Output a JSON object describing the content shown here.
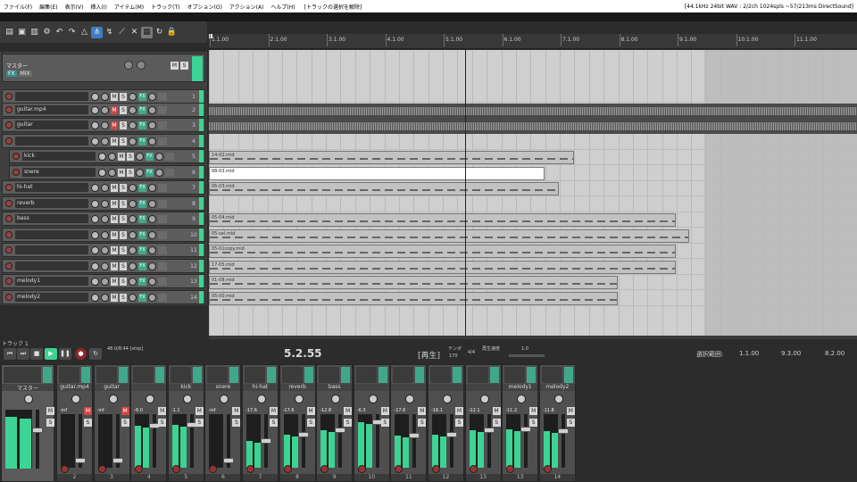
{
  "menu": {
    "items": [
      "ファイル(F)",
      "編集(E)",
      "表示(V)",
      "挿入(I)",
      "アイテム(M)",
      "トラック(T)",
      "オプション(O)",
      "アクション(A)",
      "ヘルプ(H)"
    ],
    "unselect_tracks": "[トラックの選択を解除]",
    "status": "[44.1kHz 24bit WAV : 2/2ch 1024spls ~57/213ms DirectSound]"
  },
  "ruler": {
    "ticks": [
      "1.1.00",
      "2.1.00",
      "3.1.00",
      "4.1.00",
      "5.1.00",
      "6.1.00",
      "7.1.00",
      "8.1.00",
      "9.1.00",
      "10.1.00",
      "11.1.00"
    ]
  },
  "master": {
    "label": "マスター",
    "fx": "FX",
    "io": "MIX",
    "mute": "M",
    "solo": "S"
  },
  "tracks": [
    {
      "name": "",
      "num": "1",
      "muted": false
    },
    {
      "name": "guitar.mp4",
      "num": "2",
      "muted": true
    },
    {
      "name": "guitar",
      "num": "3",
      "muted": true
    },
    {
      "name": "",
      "num": "4",
      "muted": false
    },
    {
      "name": "kick",
      "num": "5",
      "muted": false
    },
    {
      "name": "snere",
      "num": "6",
      "muted": false
    },
    {
      "name": "hi-hat",
      "num": "7",
      "muted": false
    },
    {
      "name": "reverb",
      "num": "8",
      "muted": false
    },
    {
      "name": "bass",
      "num": "9",
      "muted": false
    },
    {
      "name": "",
      "num": "10",
      "muted": false
    },
    {
      "name": "",
      "num": "11",
      "muted": false
    },
    {
      "name": "",
      "num": "12",
      "muted": false
    },
    {
      "name": "melody1",
      "num": "13",
      "muted": false
    },
    {
      "name": "melody2",
      "num": "14",
      "muted": false
    }
  ],
  "items": [
    {
      "lane": 4,
      "name": "14-02.mid",
      "start": 0,
      "end": 409,
      "style": "midi"
    },
    {
      "lane": 5,
      "name": "08-03.mid",
      "start": 0,
      "end": 376,
      "style": "white"
    },
    {
      "lane": 6,
      "name": "05-03.mid",
      "start": 0,
      "end": 392,
      "style": "midi"
    },
    {
      "lane": 8,
      "name": "05-04.mid",
      "start": 0,
      "end": 523,
      "style": "midi"
    },
    {
      "lane": 9,
      "name": "05-sel.mid",
      "start": 0,
      "end": 538,
      "style": "midi"
    },
    {
      "lane": 10,
      "name": "05-01copy.mid",
      "start": 0,
      "end": 523,
      "style": "midi"
    },
    {
      "lane": 11,
      "name": "17-05.mid",
      "start": 0,
      "end": 523,
      "style": "midi"
    },
    {
      "lane": 12,
      "name": "01-08.mid",
      "start": 0,
      "end": 458,
      "style": "midi"
    },
    {
      "lane": 13,
      "name": "05-00.mid",
      "start": 0,
      "end": 458,
      "style": "midi"
    }
  ],
  "transport": {
    "track_label": "トラック 1",
    "rate": "48.0/8.44\n[stop]",
    "position": "5.2.55",
    "state": "[再生]",
    "tempo_label": "テンポ",
    "tempo": "170",
    "sig": "4/4",
    "rate_label": "再生速度",
    "rate_value": "1.0",
    "selection_label": "選択範囲:",
    "sel_start": "1.1.00",
    "sel_end": "9.3.00",
    "sel_len": "8.2.00"
  },
  "mixer": {
    "master_label": "マスター",
    "strips": [
      {
        "name": "guitar.mp4",
        "num": "2",
        "vol": "-inf",
        "level": 0.0,
        "muted": true
      },
      {
        "name": "guitar",
        "num": "3",
        "vol": "-inf",
        "level": 0.0,
        "muted": true
      },
      {
        "name": "",
        "num": "4",
        "vol": "-6.0",
        "level": 0.78
      },
      {
        "name": "kick",
        "num": "5",
        "vol": "-1.1",
        "level": 0.8
      },
      {
        "name": "snere",
        "num": "6",
        "vol": "-inf",
        "level": 0.0
      },
      {
        "name": "hi-hat",
        "num": "7",
        "vol": "-17.6",
        "level": 0.5
      },
      {
        "name": "reverb",
        "num": "8",
        "vol": "-17.6",
        "level": 0.62
      },
      {
        "name": "bass",
        "num": "9",
        "vol": "-12.8",
        "level": 0.7
      },
      {
        "name": "",
        "num": "10",
        "vol": "-6.3",
        "level": 0.85
      },
      {
        "name": "",
        "num": "11",
        "vol": "-17.6",
        "level": 0.6
      },
      {
        "name": "",
        "num": "12",
        "vol": "-16.1",
        "level": 0.62
      },
      {
        "name": "",
        "num": "13",
        "vol": "-12.1",
        "level": 0.7
      },
      {
        "name": "melody1",
        "num": "13",
        "vol": "-11.2",
        "level": 0.72
      },
      {
        "name": "melody2",
        "num": "14",
        "vol": "-11.8",
        "level": 0.68
      }
    ]
  }
}
